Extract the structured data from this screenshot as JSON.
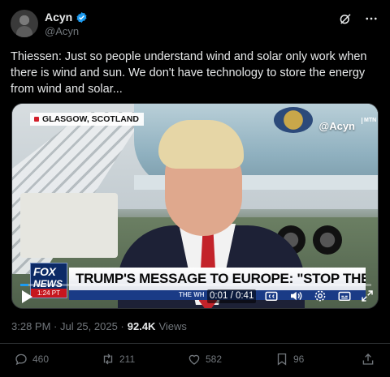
{
  "author": {
    "display_name": "Acyn",
    "handle": "@Acyn",
    "avatar_icon": "avatar-photo",
    "verified_color": "#1d9bf0"
  },
  "tweet": {
    "text": "Thiessen: Just so people understand wind and solar only work when there is wind and sun. We don't have technology to store the energy from wind and solar..."
  },
  "video": {
    "location_label": "GLASGOW, SCOTLAND",
    "watermark": "@Acyn",
    "watermark_tag": "MTN",
    "network_logo_top": "FOX",
    "network_logo_bottom": "NEWS",
    "network_time": "1:24 PT",
    "headline": "TRUMP'S MESSAGE TO EUROPE: \"STOP THE WINDMILLS\"",
    "ticker_text": "THE WH",
    "time_readout": "0:01 / 0:41",
    "progress_fraction": 0.024,
    "controls": [
      "play-icon",
      "captions-icon",
      "volume-icon",
      "settings-icon",
      "fullscreen-icon"
    ]
  },
  "meta": {
    "timestamp": "3:28 PM · Jul 25, 2025 ·",
    "views_count": "92.4K",
    "views_label": "Views"
  },
  "actions": {
    "replies": "460",
    "reposts": "211",
    "likes": "582",
    "bookmarks": "96"
  },
  "colors": {
    "background": "#000000",
    "accent": "#1d9bf0",
    "muted_text": "#71767b",
    "fox_red": "#c7161e",
    "fox_blue": "#0c2a66"
  }
}
